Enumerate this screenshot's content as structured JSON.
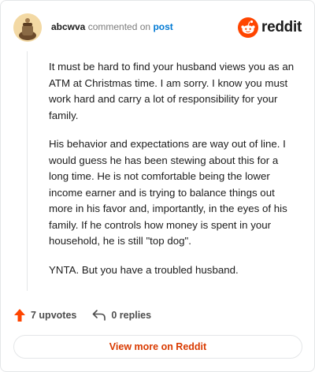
{
  "header": {
    "username": "abcwva",
    "verb": "commented on",
    "post_link": "post",
    "brand_name": "reddit"
  },
  "comment": {
    "paragraphs": [
      "It must be hard to find your husband views you as an ATM at Christmas time. I am sorry. I know you must work hard and carry a lot of responsibility for your family.",
      "His behavior and expectations are way out of line. I would guess he has been stewing about this for a long time. He is not comfortable being the lower income earner and is trying to balance things out more in his favor and, importantly, in the eyes of his family. If he controls how money is spent in your household, he is still \"top dog\".",
      "YNTA. But you have a troubled husband."
    ]
  },
  "actions": {
    "upvotes": "7 upvotes",
    "replies": "0 replies"
  },
  "footer": {
    "view_more_label": "View more on Reddit"
  },
  "colors": {
    "brand_orange": "#ff4500",
    "upvote_red": "#ff4500",
    "link_blue": "#0079d3",
    "button_text": "#d93a00"
  },
  "icons": {
    "avatar": "avatar-icon",
    "brand": "reddit-logo-icon",
    "upvote": "upvote-arrow-icon",
    "reply": "reply-arrow-icon"
  }
}
